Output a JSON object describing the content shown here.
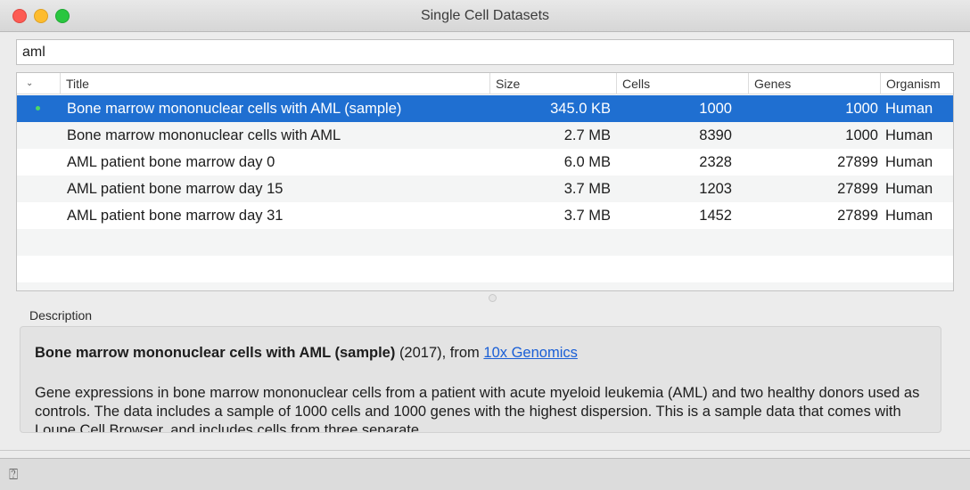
{
  "window": {
    "title": "Single Cell Datasets"
  },
  "search": {
    "value": "aml"
  },
  "table": {
    "columns": [
      "Title",
      "Size",
      "Cells",
      "Genes",
      "Organism"
    ],
    "rows": [
      {
        "title": "Bone marrow mononuclear cells with AML (sample)",
        "size": "345.0 KB",
        "cells": "1000",
        "genes": "1000",
        "organism": "Human",
        "selected": true
      },
      {
        "title": "Bone marrow mononuclear cells with AML",
        "size": "2.7 MB",
        "cells": "8390",
        "genes": "1000",
        "organism": "Human"
      },
      {
        "title": "AML patient bone marrow day 0",
        "size": "6.0 MB",
        "cells": "2328",
        "genes": "27899",
        "organism": "Human"
      },
      {
        "title": "AML patient bone marrow day 15",
        "size": "3.7 MB",
        "cells": "1203",
        "genes": "27899",
        "organism": "Human"
      },
      {
        "title": "AML patient bone marrow day 31",
        "size": "3.7 MB",
        "cells": "1452",
        "genes": "27899",
        "organism": "Human"
      }
    ]
  },
  "description": {
    "label": "Description",
    "title": "Bone marrow mononuclear cells with AML (sample)",
    "year": "(2017), from",
    "source_link": "10x Genomics",
    "body": "Gene expressions in bone marrow mononuclear cells from a patient with acute myeloid leukemia (AML) and two healthy donors used as controls. The data includes a sample of 1000 cells and 1000 genes with the highest dispersion. This is a sample data that comes with Loupe Cell Browser, and includes cells from three separate"
  },
  "icons": {
    "sort": "chevron-down-icon",
    "status": "green-dot-icon",
    "help": "help-icon"
  },
  "colors": {
    "selection": "#1f6fd1",
    "link": "#1a5fd6",
    "status_dot": "#4cd964"
  }
}
